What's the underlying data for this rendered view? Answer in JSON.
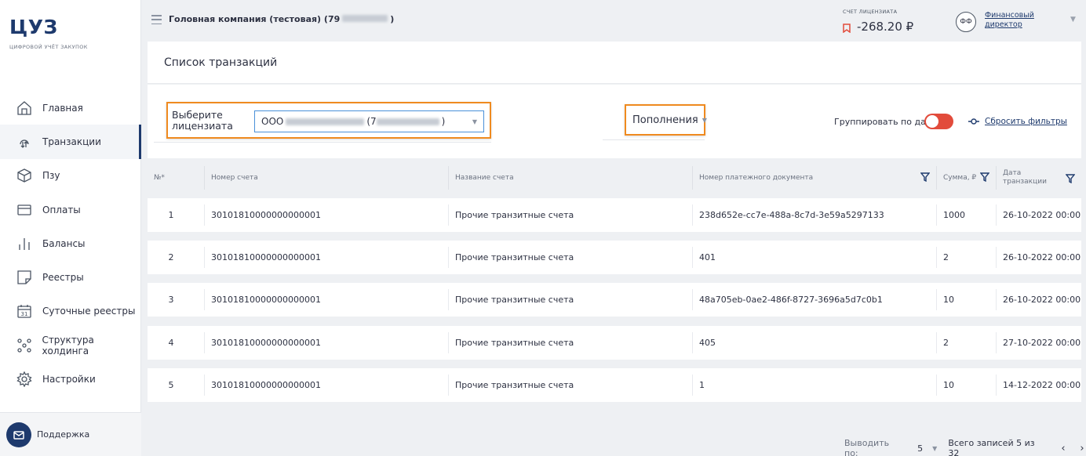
{
  "brand": {
    "logo": "ЦУЗ",
    "subtitle": "ЦИФРОВОЙ УЧЁТ ЗАКУПОК"
  },
  "sidebar": {
    "items": [
      {
        "label": "Главная",
        "icon": "home-icon",
        "active": false
      },
      {
        "label": "Транзакции",
        "icon": "transactions-icon",
        "active": true
      },
      {
        "label": "Пзу",
        "icon": "box-icon",
        "active": false
      },
      {
        "label": "Оплаты",
        "icon": "card-icon",
        "active": false
      },
      {
        "label": "Балансы",
        "icon": "bars-icon",
        "active": false
      },
      {
        "label": "Реестры",
        "icon": "note-icon",
        "active": false
      },
      {
        "label": "Суточные реестры",
        "icon": "calendar-icon",
        "active": false
      },
      {
        "label": "Структура холдинга",
        "icon": "hierarchy-icon",
        "active": false
      },
      {
        "label": "Настройки",
        "icon": "gear-icon",
        "active": false
      }
    ],
    "support_label": "Поддержка",
    "calendar_day": "31"
  },
  "topbar": {
    "company": "Головная компания (тестовая) (79",
    "company_suffix": ")",
    "account_label": "СЧЕТ ЛИЦЕНЗИАТА",
    "account_value": "-268.20 ₽",
    "avatar_initials": "ФФ",
    "role_line1": "Финансовый",
    "role_line2": "директор"
  },
  "page": {
    "title": "Список транзакций"
  },
  "filters": {
    "licensee_label": "Выберите лицензиата",
    "licensee_prefix": "ООО",
    "licensee_mid": "(7",
    "licensee_suffix": ")",
    "type_value": "Пополнения",
    "group_label": "Группировать по дате",
    "group_toggle_on": true,
    "reset_label": "Сбросить фильтры"
  },
  "table": {
    "columns": [
      "№*",
      "Номер счета",
      "Название счета",
      "Номер платежного документа",
      "Сумма, ₽",
      "Дата транзакции"
    ],
    "rows": [
      {
        "n": "1",
        "account": "30101810000000000001",
        "name": "Прочие транзитные счета",
        "doc": "238d652e-cc7e-488a-8c7d-3e59a5297133",
        "sum": "1000",
        "date": "26-10-2022 00:00"
      },
      {
        "n": "2",
        "account": "30101810000000000001",
        "name": "Прочие транзитные счета",
        "doc": "401",
        "sum": "2",
        "date": "26-10-2022 00:00"
      },
      {
        "n": "3",
        "account": "30101810000000000001",
        "name": "Прочие транзитные счета",
        "doc": "48a705eb-0ae2-486f-8727-3696a5d7c0b1",
        "sum": "10",
        "date": "26-10-2022 00:00"
      },
      {
        "n": "4",
        "account": "30101810000000000001",
        "name": "Прочие транзитные счета",
        "doc": "405",
        "sum": "2",
        "date": "27-10-2022 00:00"
      },
      {
        "n": "5",
        "account": "30101810000000000001",
        "name": "Прочие транзитные счета",
        "doc": "1",
        "sum": "10",
        "date": "14-12-2022 00:00"
      }
    ]
  },
  "pager": {
    "per_page_label": "Выводить по:",
    "per_page": "5",
    "total": "Всего записей 5 из 32",
    "prev": "‹",
    "next": "›"
  },
  "colors": {
    "brand": "#1e3a6d",
    "highlight": "#ef8a1f",
    "toggle": "#e24b3b",
    "select_border": "#4a90d9"
  }
}
